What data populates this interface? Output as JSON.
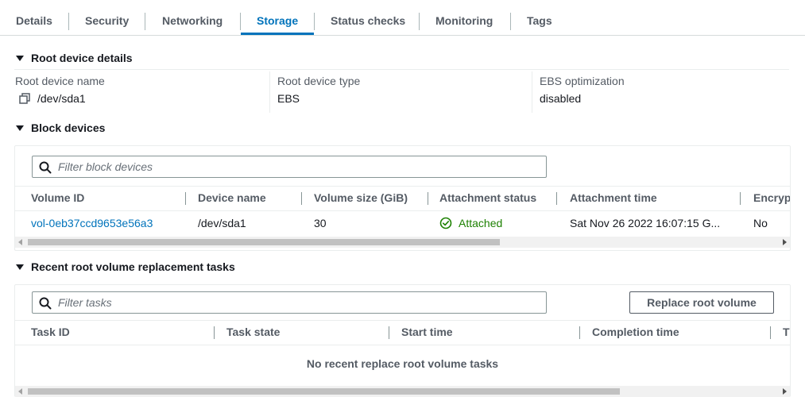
{
  "tabs": [
    "Details",
    "Security",
    "Networking",
    "Storage",
    "Status checks",
    "Monitoring",
    "Tags"
  ],
  "active_tab": "Storage",
  "root_device": {
    "title": "Root device details",
    "name_label": "Root device name",
    "name_value": "/dev/sda1",
    "type_label": "Root device type",
    "type_value": "EBS",
    "ebs_label": "EBS optimization",
    "ebs_value": "disabled"
  },
  "block_devices": {
    "title": "Block devices",
    "filter_placeholder": "Filter block devices",
    "columns": [
      "Volume ID",
      "Device name",
      "Volume size (GiB)",
      "Attachment status",
      "Attachment time",
      "Encryp"
    ],
    "rows": [
      {
        "volume_id": "vol-0eb37ccd9653e56a3",
        "device_name": "/dev/sda1",
        "size": "30",
        "status": "Attached",
        "time": "Sat Nov 26 2022 16:07:15 G...",
        "encrypted": "No"
      }
    ],
    "scroll_fraction": 0.63
  },
  "replacement_tasks": {
    "title": "Recent root volume replacement tasks",
    "filter_placeholder": "Filter tasks",
    "button_label": "Replace root volume",
    "columns": [
      "Task ID",
      "Task state",
      "Start time",
      "Completion time",
      "T"
    ],
    "empty_message": "No recent replace root volume tasks",
    "scroll_fraction": 0.79
  },
  "colors": {
    "link": "#0073bb",
    "success": "#1d8102",
    "active_tab": "#0073bb"
  },
  "icons": {
    "section_toggle": "caret-down-icon",
    "copy": "copy-icon",
    "search": "search-icon",
    "status": "check-circle-icon"
  }
}
